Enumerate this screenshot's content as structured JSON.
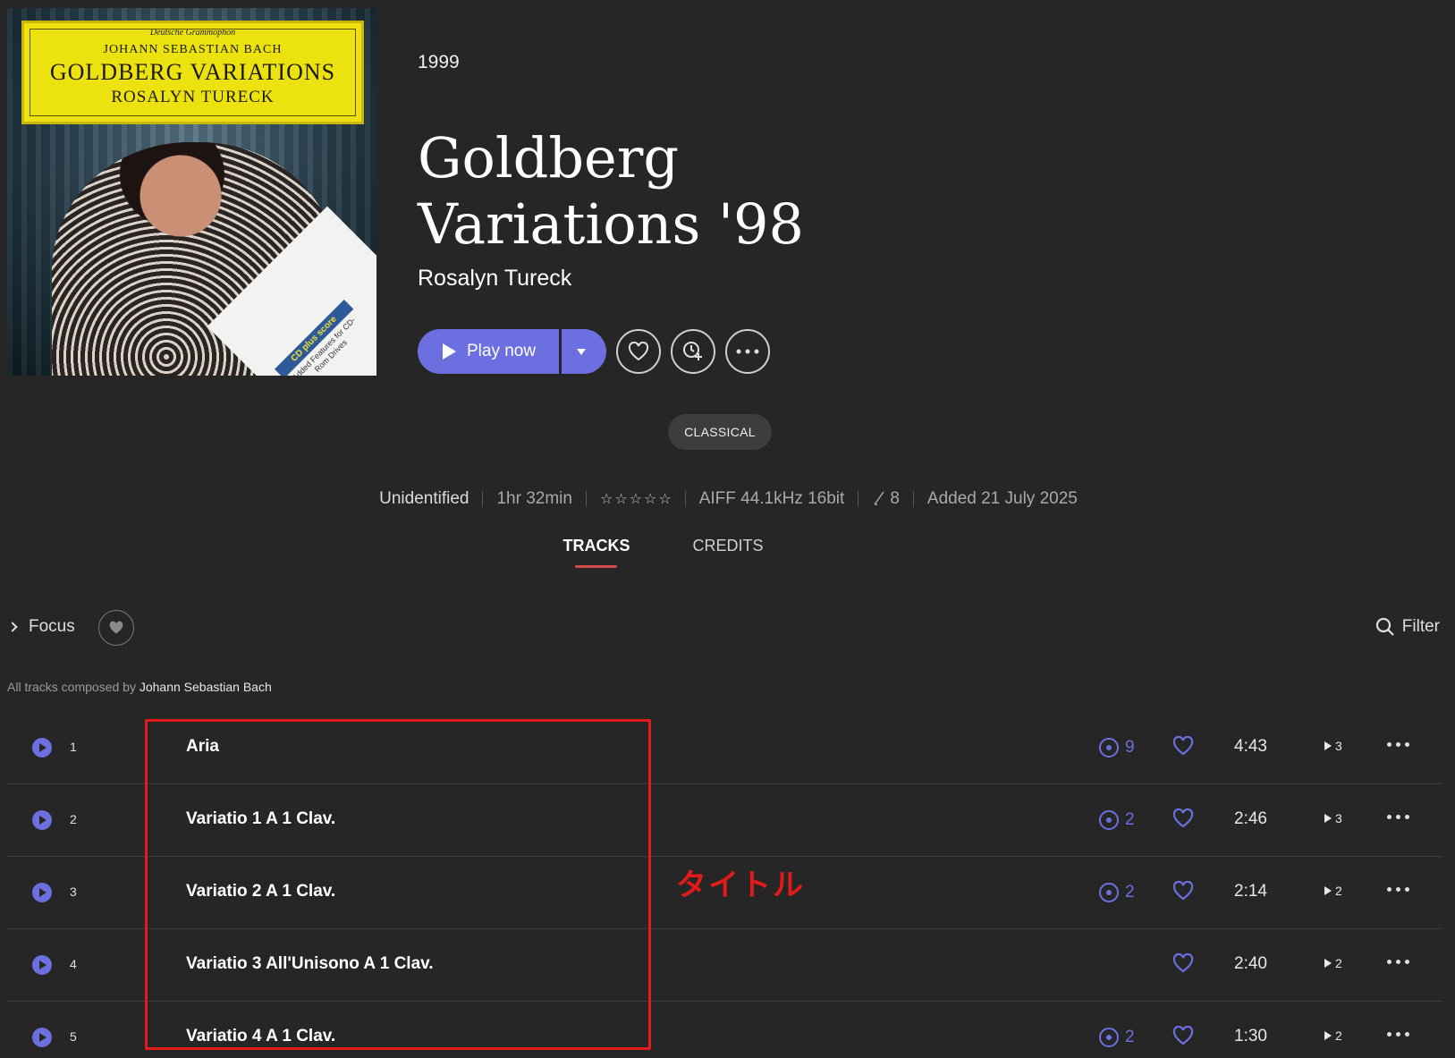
{
  "album": {
    "year": "1999",
    "title_line1": "Goldberg",
    "title_line2": "Variations '98",
    "artist": "Rosalyn Tureck",
    "cover": {
      "label_top": "Deutsche Grammophon",
      "composer": "JOHANN SEBASTIAN BACH",
      "work": "GOLDBERG VARIATIONS",
      "performer": "ROSALYN TURECK",
      "sticker_logo": "CD plus score",
      "sticker_text": "Added Features for CD-Rom Drives"
    }
  },
  "actions": {
    "play_label": "Play now"
  },
  "genre": "CLASSICAL",
  "meta": {
    "status": "Unidentified",
    "duration": "1hr 32min",
    "rating": 0,
    "format": "AIFF 44.1kHz 16bit",
    "loudness": "8",
    "added": "Added 21 July 2025"
  },
  "tabs": [
    {
      "label": "TRACKS",
      "active": true
    },
    {
      "label": "CREDITS",
      "active": false
    }
  ],
  "toolbar": {
    "focus_label": "Focus",
    "filter_label": "Filter"
  },
  "composer_line": {
    "prefix": "All tracks composed by",
    "name": "Johann Sebastian Bach"
  },
  "tracks": [
    {
      "num": "1",
      "title": "Aria",
      "plays": "9",
      "duration": "4:43",
      "play_count": "3"
    },
    {
      "num": "2",
      "title": "Variatio 1 A 1 Clav.",
      "plays": "2",
      "duration": "2:46",
      "play_count": "3"
    },
    {
      "num": "3",
      "title": "Variatio 2 A 1 Clav.",
      "plays": "2",
      "duration": "2:14",
      "play_count": "2"
    },
    {
      "num": "4",
      "title": "Variatio 3 All'Unisono A 1 Clav.",
      "plays": "",
      "duration": "2:40",
      "play_count": "2"
    },
    {
      "num": "5",
      "title": "Variatio 4 A 1 Clav.",
      "plays": "2",
      "duration": "1:30",
      "play_count": "2"
    }
  ],
  "annotation": {
    "label": "タイトル",
    "color": "#e11a1a"
  },
  "colors": {
    "accent": "#6c6fe0",
    "background": "#262626",
    "tab_underline": "#d04a4a"
  }
}
